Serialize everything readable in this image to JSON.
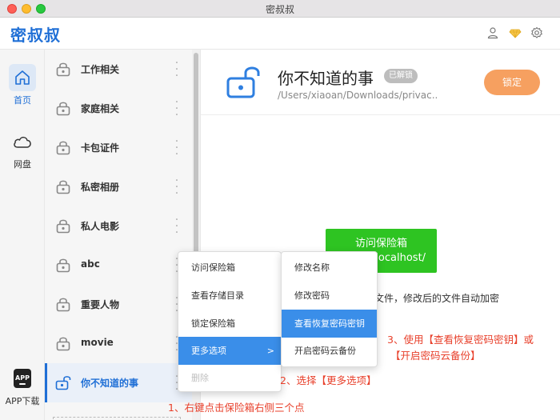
{
  "window": {
    "title": "密叔叔"
  },
  "header": {
    "brand": "密叔叔",
    "icons": [
      "user-icon",
      "gem-icon",
      "gear-icon"
    ],
    "brand_color": "#1f6fd6"
  },
  "rail": {
    "items": [
      {
        "label": "首页",
        "icon": "home-icon",
        "active": true
      },
      {
        "label": "网盘",
        "icon": "cloud-icon",
        "active": false
      },
      {
        "label": "APP下载",
        "icon": "app-icon",
        "active": false
      }
    ],
    "app_icon_text": "APP"
  },
  "vaults": [
    {
      "name": "工作相关"
    },
    {
      "name": "家庭相关"
    },
    {
      "name": "卡包证件"
    },
    {
      "name": "私密相册"
    },
    {
      "name": "私人电影"
    },
    {
      "name": "abc"
    },
    {
      "name": "重要人物"
    },
    {
      "name": "movie"
    },
    {
      "name": "你不知道的事",
      "selected": true,
      "unlocked": true
    }
  ],
  "detail": {
    "title": "你不知道的事",
    "badge": "已解锁",
    "path": "/Users/xiaoan/Downloads/privac...",
    "lock_button": "锁定",
    "visit_button_line1": "访问保险箱",
    "visit_button_line2": "/localhost/",
    "hint": "内文件，修改后的文件自动加密",
    "accent_color": "#f6a060",
    "visit_color": "#2ec422"
  },
  "context_menu": {
    "items": [
      "访问保险箱",
      "查看存储目录",
      "锁定保险箱",
      "更多选项",
      "删除"
    ],
    "highlighted": "更多选项",
    "disabled": "删除"
  },
  "submenu": {
    "items": [
      "修改名称",
      "修改密码",
      "查看恢复密码密钥",
      "开启密码云备份"
    ],
    "highlighted": "查看恢复密码密钥"
  },
  "annotations": {
    "step1": "1、右键点击保险箱右侧三个点",
    "step2": "2、选择【更多选项】",
    "step3_line1": "3、使用【查看恢复密码密钥】或",
    "step3_line2": "【开启密码云备份】",
    "color": "#e8402b"
  }
}
